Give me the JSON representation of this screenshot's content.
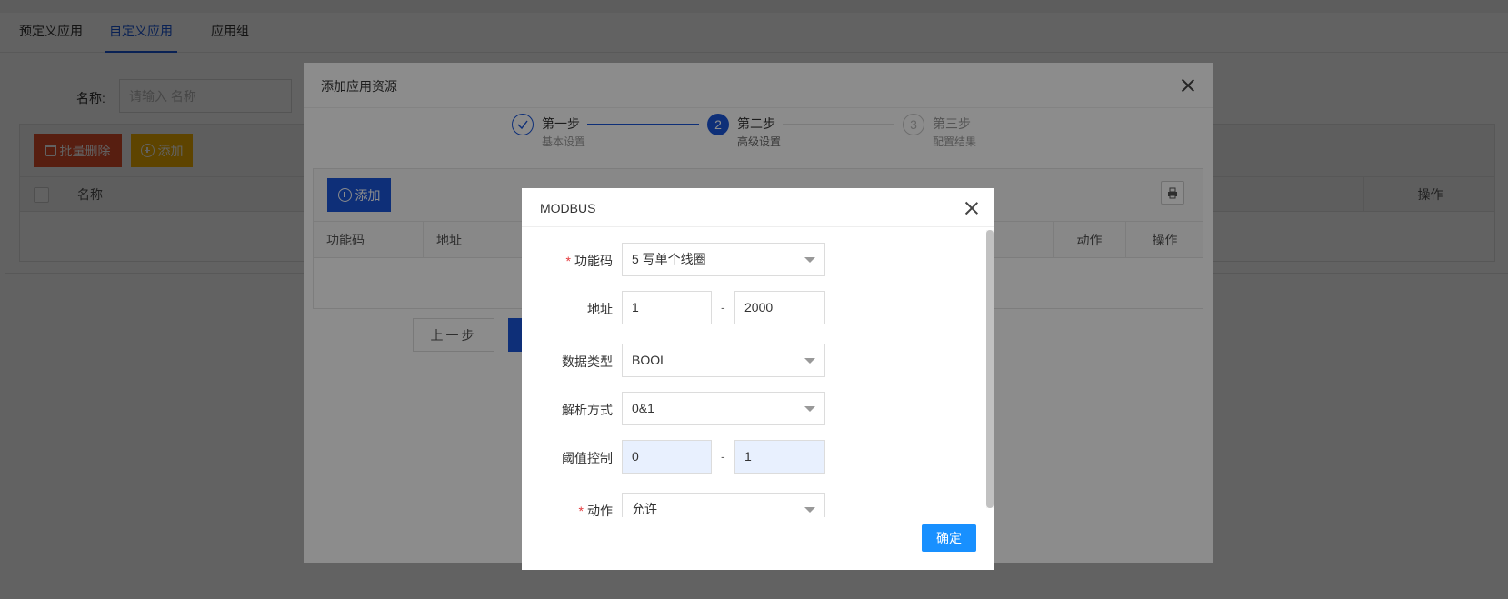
{
  "tabs": [
    "预定义应用",
    "自定义应用",
    "应用组"
  ],
  "filter": {
    "label": "名称:",
    "placeholder": "请输入 名称"
  },
  "toolbar": {
    "batch_delete_label": "批量删除",
    "add_label": "添加"
  },
  "table": {
    "columns": [
      "名称",
      "操作"
    ]
  },
  "modal": {
    "title": "添加应用资源",
    "steps": [
      {
        "number": "1",
        "title": "第一步",
        "desc": "基本设置",
        "status": "done"
      },
      {
        "number": "2",
        "title": "第二步",
        "desc": "高级设置",
        "status": "active"
      },
      {
        "number": "3",
        "title": "第三步",
        "desc": "配置结果",
        "status": "wait"
      }
    ],
    "add_label": "添加",
    "columns": [
      "功能码",
      "地址",
      "动作",
      "操作"
    ],
    "prev_label": "上一步"
  },
  "dialog": {
    "title": "MODBUS",
    "fields": {
      "function_code": {
        "label": "功能码",
        "value": "5 写单个线圈"
      },
      "address": {
        "label": "地址",
        "from": "1",
        "to": "2000"
      },
      "data_type": {
        "label": "数据类型",
        "value": "BOOL"
      },
      "parse_mode": {
        "label": "解析方式",
        "value": "0&1"
      },
      "threshold": {
        "label": "阈值控制",
        "from": "0",
        "to": "1"
      },
      "action": {
        "label": "动作",
        "value": "允许"
      }
    },
    "range_separator": "-",
    "required_mark": "*",
    "ok_label": "确定"
  },
  "colors": {
    "primary": "#1a56db",
    "danger": "#e4502c",
    "warning": "#f5b400",
    "confirm": "#1890ff"
  }
}
